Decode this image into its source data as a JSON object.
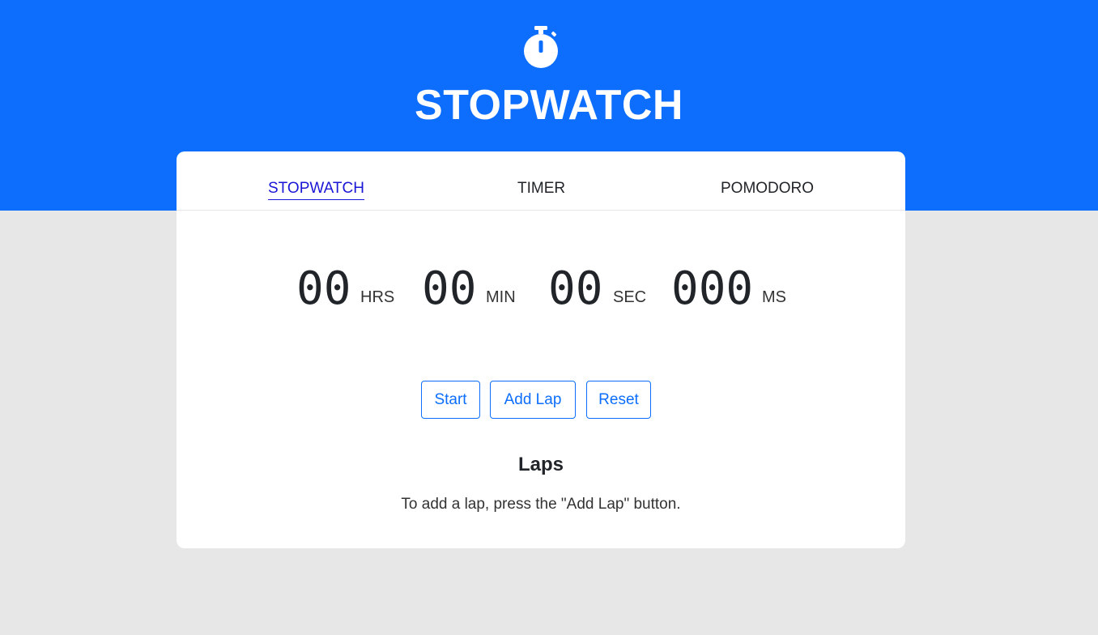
{
  "header": {
    "icon": "stopwatch-icon",
    "title": "STOPWATCH",
    "background_color": "#0d6efd"
  },
  "tabs": [
    {
      "label": "STOPWATCH",
      "active": true
    },
    {
      "label": "TIMER",
      "active": false
    },
    {
      "label": "POMODORO",
      "active": false
    }
  ],
  "display": {
    "hours": "00",
    "hours_unit": "HRS",
    "minutes": "00",
    "minutes_unit": "MIN",
    "seconds": "00",
    "seconds_unit": "SEC",
    "milliseconds": "000",
    "milliseconds_unit": "MS"
  },
  "buttons": {
    "start_label": "Start",
    "add_lap_label": "Add Lap",
    "reset_label": "Reset",
    "accent_color": "#0d6efd"
  },
  "laps": {
    "title": "Laps",
    "empty_message": "To add a lap, press the \"Add Lap\" button."
  }
}
